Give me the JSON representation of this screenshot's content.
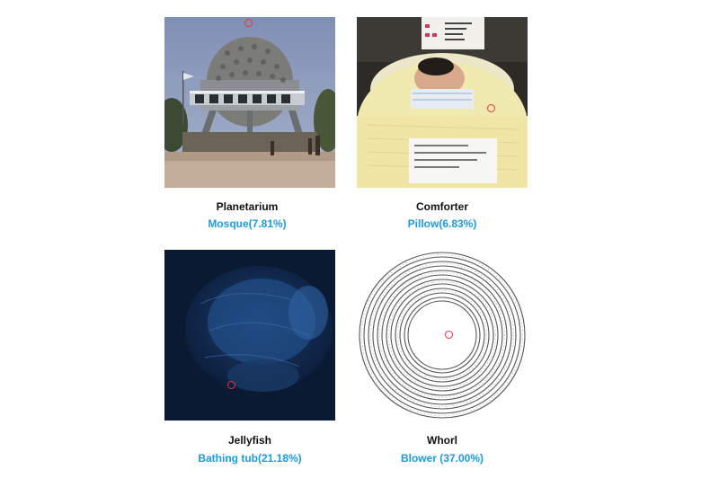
{
  "accent_color": "#1a9be0",
  "marker_color": "#e8333a",
  "panels": [
    {
      "true_label": "Planetarium",
      "prediction": "Mosque(7.81%)",
      "image": "planetarium-dome-photo"
    },
    {
      "true_label": "Comforter",
      "prediction": "Pillow(6.83%)",
      "image": "newborn-baby-in-crib-photo"
    },
    {
      "true_label": "Jellyfish",
      "prediction": "Bathing tub(21.18%)",
      "image": "blue-jellyfish-photo"
    },
    {
      "true_label": "Whorl",
      "prediction": "Blower (37.00%)",
      "image": "concentric-rings-whorl-image"
    }
  ]
}
